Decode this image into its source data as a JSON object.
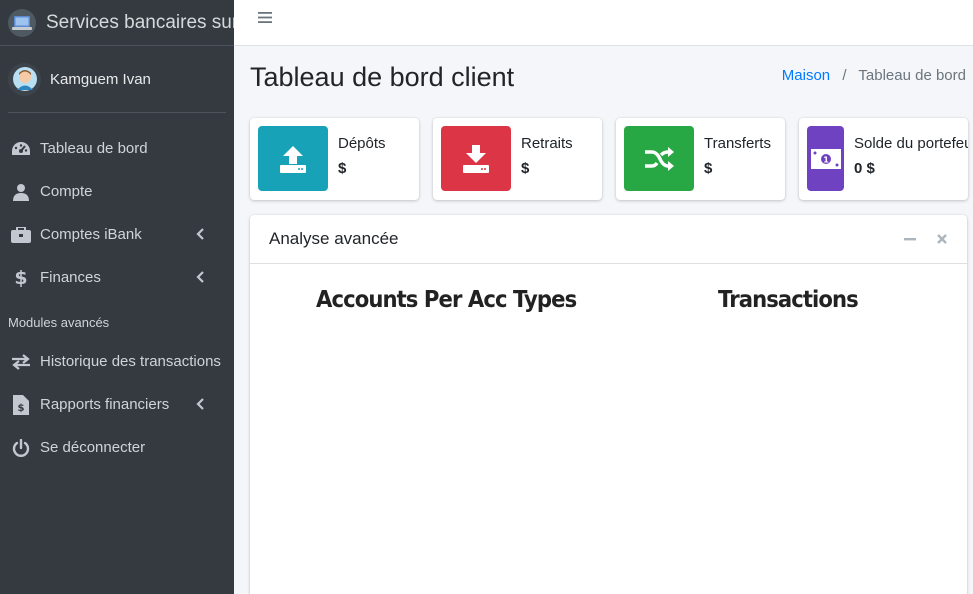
{
  "brand": {
    "title": "Services bancaires sur I"
  },
  "user": {
    "name": "Kamguem Ivan"
  },
  "sidebar": {
    "items": [
      {
        "label": "Tableau de bord",
        "icon": "tachometer-icon"
      },
      {
        "label": "Compte",
        "icon": "user-icon"
      },
      {
        "label": "Comptes iBank",
        "icon": "briefcase-icon"
      },
      {
        "label": "Finances",
        "icon": "dollar-icon"
      }
    ],
    "section_header": "Modules avancés",
    "advanced_items": [
      {
        "label": "Historique des transactions",
        "icon": "exchange-icon"
      },
      {
        "label": "Rapports financiers",
        "icon": "file-invoice-dollar-icon"
      },
      {
        "label": "Se déconnecter",
        "icon": "power-off-icon"
      }
    ]
  },
  "header": {
    "title": "Tableau de bord client",
    "breadcrumb": {
      "home": "Maison",
      "current": "Tableau de bord"
    }
  },
  "info_boxes": [
    {
      "label": "Dépôts",
      "value": "$",
      "color": "#17a2b8",
      "icon": "upload-icon"
    },
    {
      "label": "Retraits",
      "value": "$",
      "color": "#dc3545",
      "icon": "download-icon"
    },
    {
      "label": "Transferts",
      "value": "$",
      "color": "#28a745",
      "icon": "random-icon"
    },
    {
      "label": "Solde du portefeuille",
      "value": "0 $",
      "color": "#6f42c1",
      "icon": "money-bill-icon"
    }
  ],
  "card": {
    "title": "Analyse avancée",
    "chart_titles": [
      "Accounts Per Acc Types",
      "Transactions"
    ]
  },
  "colors": {
    "sidebar_bg": "#343a40",
    "link": "#007bff",
    "page_bg": "#f4f6f9"
  }
}
